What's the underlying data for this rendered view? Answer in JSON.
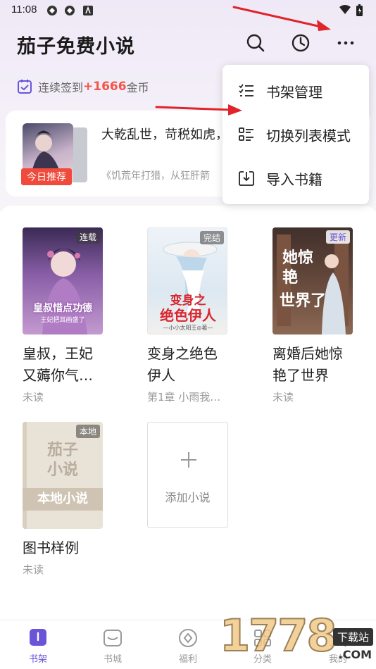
{
  "status_bar": {
    "time": "11:08"
  },
  "header": {
    "title": "茄子免费小说"
  },
  "signin": {
    "prefix": "连续签到",
    "coins": "+1666",
    "suffix": "金币"
  },
  "recommend": {
    "badge": "今日推荐",
    "text": "大乾乱世，苛税如虎，草芥。…",
    "source": "《饥荒年打猎，从狂肝箭"
  },
  "menu": {
    "items": [
      {
        "label": "书架管理",
        "icon": "checklist-icon"
      },
      {
        "label": "切换列表模式",
        "icon": "list-grid-icon"
      },
      {
        "label": "导入书籍",
        "icon": "import-icon"
      }
    ]
  },
  "books": [
    {
      "title": "皇叔，王妃又薅你气…",
      "sub": "未读",
      "tag": "连载",
      "cover_text": "皇叔惜点功德",
      "cover_sub": "王妃把耳画盛了"
    },
    {
      "title": "变身之绝色伊人",
      "sub": "第1章 小雨我…",
      "tag": "完结",
      "cover_text_1": "变身之",
      "cover_text_2": "绝色伊人",
      "cover_author": "—小小太阳王◎著—"
    },
    {
      "title": "离婚后她惊艳了世界",
      "sub": "未读",
      "tag": "更新",
      "cover_text_1": "她惊艳",
      "cover_text_2": "世界了"
    },
    {
      "title": "图书样例",
      "sub": "未读",
      "tag": "本地",
      "cover_text_1": "茄子",
      "cover_text_2": "小说",
      "cover_band": "本地小说"
    }
  ],
  "add_book": {
    "label": "添加小说"
  },
  "tabs": [
    {
      "label": "书架",
      "icon": "bookshelf-icon",
      "active": true
    },
    {
      "label": "书城",
      "icon": "store-icon",
      "active": false
    },
    {
      "label": "福利",
      "icon": "gift-icon",
      "active": false
    },
    {
      "label": "分类",
      "icon": "category-icon",
      "active": false
    },
    {
      "label": "我的",
      "icon": "profile-icon",
      "active": false
    }
  ],
  "watermark": {
    "text": "1778",
    "site": "下载站",
    "domain": ".COM"
  },
  "colors": {
    "accent": "#6a55d8",
    "highlight": "#f2564a",
    "badge": "#f04a3c"
  }
}
